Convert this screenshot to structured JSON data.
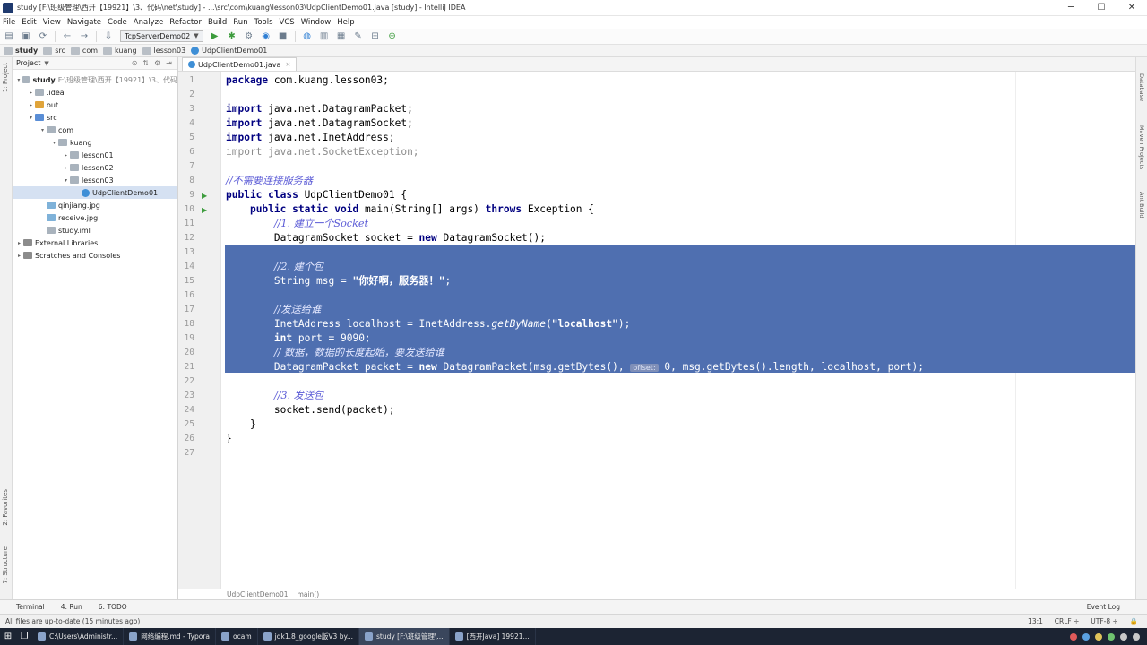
{
  "window": {
    "title": "study [F:\\班级管理\\西开【19921】\\3、代码\\net\\study] - ...\\src\\com\\kuang\\lesson03\\UdpClientDemo01.java [study] - IntelliJ IDEA",
    "minimize": "─",
    "maximize": "☐",
    "close": "✕"
  },
  "menu": [
    "File",
    "Edit",
    "View",
    "Navigate",
    "Code",
    "Analyze",
    "Refactor",
    "Build",
    "Run",
    "Tools",
    "VCS",
    "Window",
    "Help"
  ],
  "toolbar": {
    "run_config": "TcpServerDemo02"
  },
  "nav": {
    "items": [
      "study",
      "src",
      "com",
      "kuang",
      "lesson03",
      "UdpClientDemo01"
    ]
  },
  "left_strip": {
    "project": "1: Project",
    "favorites": "2: Favorites",
    "structure": "7: Structure"
  },
  "project_panel": {
    "header": "Project",
    "tree": [
      {
        "label": "study",
        "extra": "F:\\班级管理\\西开【19921】\\3、代码",
        "depth": 0,
        "arrow": "▾",
        "icon": "folder",
        "bold": true
      },
      {
        "label": ".idea",
        "extra": "",
        "depth": 1,
        "arrow": "▸",
        "icon": "folder"
      },
      {
        "label": "out",
        "extra": "",
        "depth": 1,
        "arrow": "▸",
        "icon": "orange"
      },
      {
        "label": "src",
        "extra": "",
        "depth": 1,
        "arrow": "▾",
        "icon": "blue"
      },
      {
        "label": "com",
        "extra": "",
        "depth": 2,
        "arrow": "▾",
        "icon": "folder"
      },
      {
        "label": "kuang",
        "extra": "",
        "depth": 3,
        "arrow": "▾",
        "icon": "folder"
      },
      {
        "label": "lesson01",
        "extra": "",
        "depth": 4,
        "arrow": "▸",
        "icon": "folder"
      },
      {
        "label": "lesson02",
        "extra": "",
        "depth": 4,
        "arrow": "▸",
        "icon": "folder"
      },
      {
        "label": "lesson03",
        "extra": "",
        "depth": 4,
        "arrow": "▾",
        "icon": "folder"
      },
      {
        "label": "UdpClientDemo01",
        "extra": "",
        "depth": 5,
        "arrow": "",
        "icon": "java",
        "selected": true
      },
      {
        "label": "qinjiang.jpg",
        "extra": "",
        "depth": 2,
        "arrow": "",
        "icon": "img"
      },
      {
        "label": "receive.jpg",
        "extra": "",
        "depth": 2,
        "arrow": "",
        "icon": "img"
      },
      {
        "label": "study.iml",
        "extra": "",
        "depth": 2,
        "arrow": "",
        "icon": "folder"
      },
      {
        "label": "External Libraries",
        "extra": "",
        "depth": 0,
        "arrow": "▸",
        "icon": "lib"
      },
      {
        "label": "Scratches and Consoles",
        "extra": "",
        "depth": 0,
        "arrow": "▸",
        "icon": "lib"
      }
    ]
  },
  "editor": {
    "tab_label": "UdpClientDemo01.java",
    "tab_close": "×",
    "line_numbers": [
      "1",
      "2",
      "3",
      "4",
      "5",
      "6",
      "7",
      "8",
      "9",
      "10",
      "11",
      "12",
      "13",
      "14",
      "15",
      "16",
      "17",
      "18",
      "19",
      "20",
      "21",
      "22",
      "23",
      "24",
      "25",
      "26",
      "27"
    ],
    "hint_offset": "offset:",
    "breadcrumbs": [
      "UdpClientDemo01",
      "main()"
    ]
  },
  "right_strip": {
    "database": "Database",
    "maven": "Maven Projects",
    "ant": "Ant Build"
  },
  "tool_tabs": {
    "terminal": "Terminal",
    "run": "4: Run",
    "todo": "6: TODO",
    "event_log": "Event Log"
  },
  "status": {
    "message": "All files are up-to-date (15 minutes ago)",
    "position": "13:1",
    "line_sep": "CRLF ÷",
    "encoding": "UTF-8 ÷"
  },
  "taskbar": {
    "items": [
      "C:\\Users\\Administr...",
      "网络编程.md - Typora",
      "ocam",
      "jdk1.8_google版V3 by...",
      "study [F:\\班级管理\\...",
      "[西开Java] 19921..."
    ]
  }
}
